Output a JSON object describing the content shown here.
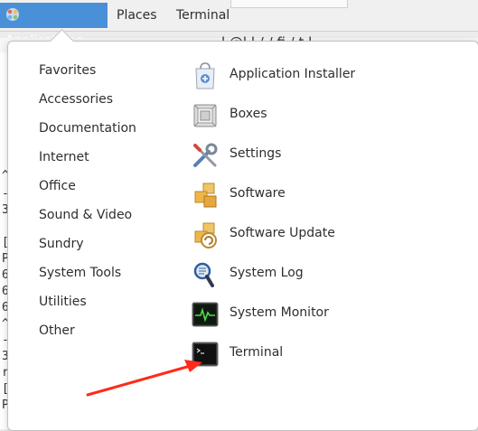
{
  "top_panel": {
    "applications": "Applications",
    "places": "Places",
    "terminal": "Terminal"
  },
  "background": {
    "title_partial": "l   @l   l    /    /   fi  /  t    l",
    "gutter_chars": [
      "^",
      "-",
      "3",
      "",
      "[",
      "P",
      "6",
      "6",
      "6",
      "^",
      "-",
      "3",
      "r",
      "[",
      "P"
    ]
  },
  "menu": {
    "categories": [
      "Favorites",
      "Accessories",
      "Documentation",
      "Internet",
      "Office",
      "Sound & Video",
      "Sundry",
      "System Tools",
      "Utilities",
      "Other"
    ],
    "apps": [
      {
        "label": "Application Installer",
        "icon": "application-installer-icon"
      },
      {
        "label": "Boxes",
        "icon": "boxes-icon"
      },
      {
        "label": "Settings",
        "icon": "settings-icon"
      },
      {
        "label": "Software",
        "icon": "software-icon"
      },
      {
        "label": "Software Update",
        "icon": "software-update-icon"
      },
      {
        "label": "System Log",
        "icon": "system-log-icon"
      },
      {
        "label": "System Monitor",
        "icon": "system-monitor-icon"
      },
      {
        "label": "Terminal",
        "icon": "terminal-icon"
      }
    ]
  },
  "colors": {
    "accent": "#4a90d9",
    "annotation_arrow": "#ff2a1a"
  }
}
